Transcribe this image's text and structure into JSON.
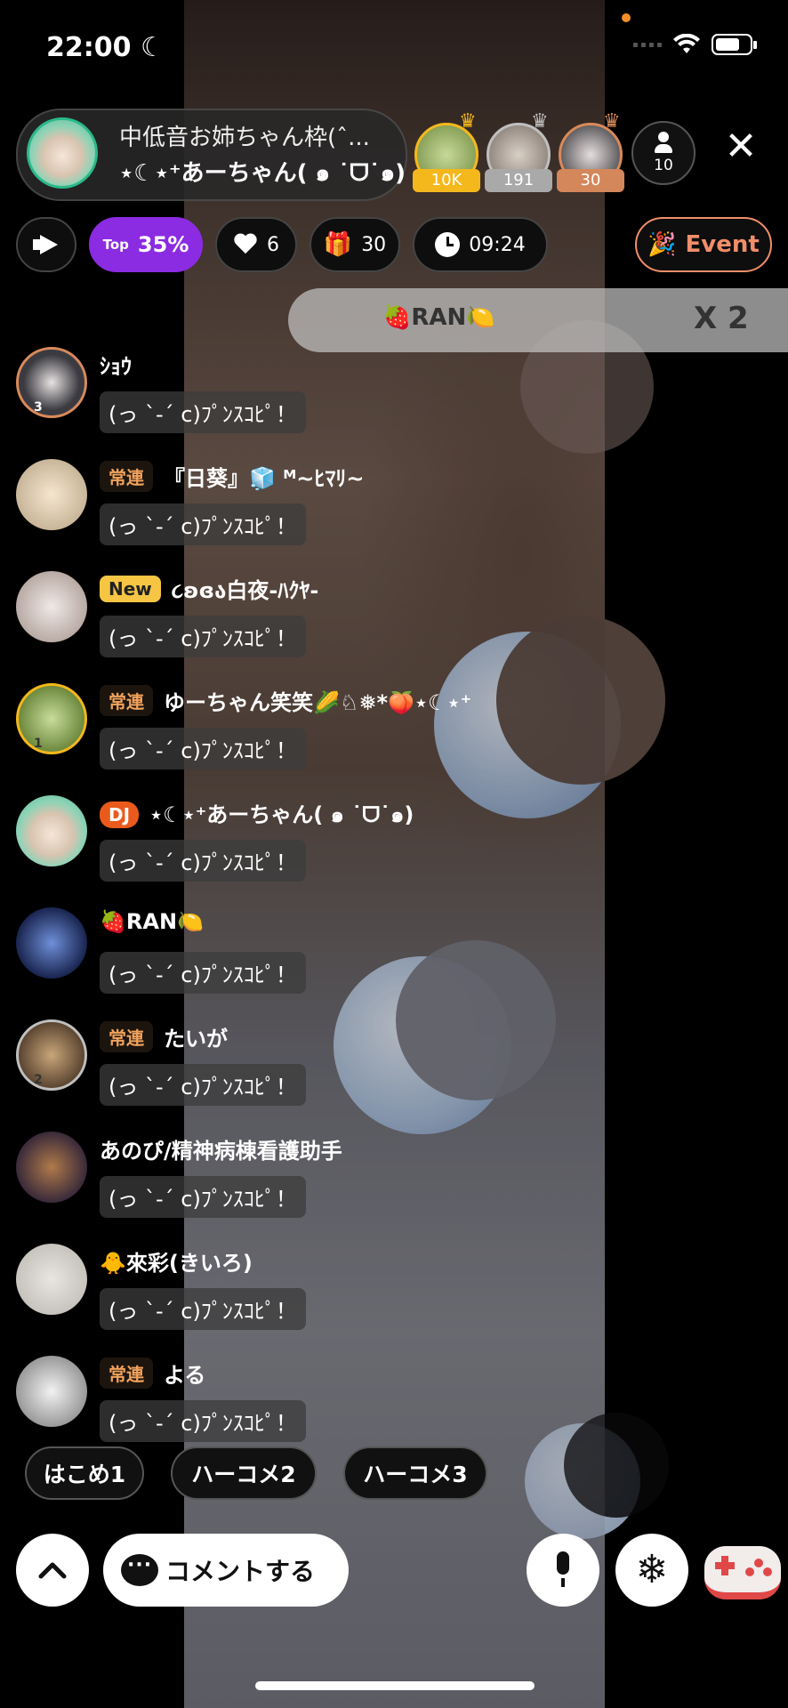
{
  "status": {
    "time": "22:00",
    "moon": "☾"
  },
  "host": {
    "title": "中低音お姉ちゃん枠(ˆ...",
    "name": "⋆☾⋆⁺あーちゃん( ๑ ˙ᗜ˙๑)"
  },
  "top_viewers": [
    {
      "count": "10K",
      "crown": "gold"
    },
    {
      "count": "191",
      "crown": "silver"
    },
    {
      "count": "30",
      "crown": "bronze"
    }
  ],
  "viewer_count": "10",
  "close_icon": "✕",
  "stats": {
    "top_small": "Top",
    "top_percent": "35%",
    "likes": "6",
    "gifts": "30",
    "timer": "09:24",
    "event_label": "Event"
  },
  "gift_banner": {
    "sender": "🍓RAN🍋",
    "multiplier": "X 2"
  },
  "comments": [
    {
      "badge": "",
      "name": "ｼｮｳ",
      "text": "(っ `-´ c)ﾌﾟﾝｽｺﾋﾟ！",
      "rank": "3"
    },
    {
      "badge": "常連",
      "name": "『日葵』🧊 ᴹ~ﾋﾏﾘ~",
      "text": "(っ `-´ c)ﾌﾟﾝｽｺﾋﾟ！",
      "rank": ""
    },
    {
      "badge": "New",
      "name": "૮ʚɞა白夜-ﾊｸﾔ-",
      "text": "(っ `-´ c)ﾌﾟﾝｽｺﾋﾟ！",
      "rank": ""
    },
    {
      "badge": "常連",
      "name": "ゆーちゃん笑笑🌽♘❅*🍑⋆☾⋆⁺",
      "text": "(っ `-´ c)ﾌﾟﾝｽｺﾋﾟ！",
      "rank": "1"
    },
    {
      "badge": "DJ",
      "name": "⋆☾⋆⁺あーちゃん( ๑ ˙ᗜ˙๑)",
      "text": "(っ `-´ c)ﾌﾟﾝｽｺﾋﾟ！",
      "rank": ""
    },
    {
      "badge": "",
      "name": "🍓RAN🍋",
      "text": "(っ `-´ c)ﾌﾟﾝｽｺﾋﾟ！",
      "rank": ""
    },
    {
      "badge": "常連",
      "name": "たいが",
      "text": "(っ `-´ c)ﾌﾟﾝｽｺﾋﾟ！",
      "rank": "2"
    },
    {
      "badge": "",
      "name": "あのぴ/精神病棟看護助手",
      "text": "(っ `-´ c)ﾌﾟﾝｽｺﾋﾟ！",
      "rank": ""
    },
    {
      "badge": "",
      "name": "🐥來彩(きいろ)",
      "text": "(っ `-´ c)ﾌﾟﾝｽｺﾋﾟ！",
      "rank": ""
    },
    {
      "badge": "常連",
      "name": "よる",
      "text": "(っ `-´ c)ﾌﾟﾝｽｺﾋﾟ！",
      "rank": ""
    }
  ],
  "quick_replies": [
    "はこめ1",
    "ハーコメ2",
    "ハーコメ3"
  ],
  "bottom": {
    "expand_icon": "^",
    "comment_label": "コメントする",
    "snowflake_icon": "❄"
  },
  "colors": {
    "accent_purple": "#8b2be2",
    "event_orange": "#f08e6a",
    "regular_badge": "#f0a25c",
    "new_badge": "#f6c544",
    "dj_badge": "#ea5a1c"
  }
}
